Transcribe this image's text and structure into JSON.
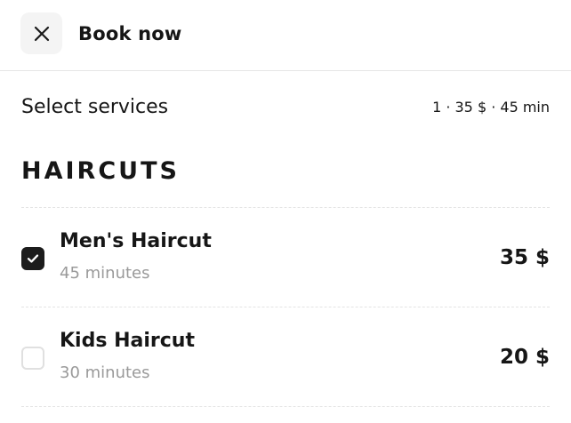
{
  "header": {
    "close_icon": "close-icon",
    "title": "Book now"
  },
  "selection": {
    "title": "Select services",
    "summary": "1 · 35 $ · 45 min"
  },
  "category": {
    "title": "HAIRCUTS"
  },
  "services": [
    {
      "name": "Men's Haircut",
      "duration": "45 minutes",
      "price": "35 $",
      "selected": true
    },
    {
      "name": "Kids Haircut",
      "duration": "30 minutes",
      "price": "20 $",
      "selected": false
    }
  ],
  "colors": {
    "text": "#161616",
    "muted": "#9a9a9a",
    "checkbox_checked": "#1c1c1c",
    "close_button_bg": "#f4f4f4"
  }
}
